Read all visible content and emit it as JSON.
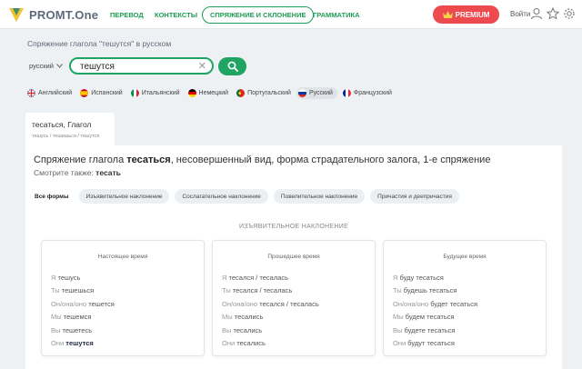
{
  "header": {
    "logo_text": "PROMT.One",
    "nav": [
      "ПЕРЕВОД",
      "КОНТЕКСТЫ",
      "СПРЯЖЕНИЕ И СКЛОНЕНИЕ",
      "ГРАММАТИКА"
    ],
    "premium_label": "PREMIUM",
    "login_label": "Войти"
  },
  "search": {
    "page_title": "Спряжение глагола \"тешутся\" в русском",
    "language": "русский",
    "query": "тешутся",
    "clear_icon": "close-icon",
    "button_icon": "search-icon"
  },
  "languages": [
    {
      "label": "Английский",
      "flag": "gb"
    },
    {
      "label": "Испанский",
      "flag": "es"
    },
    {
      "label": "Итальянский",
      "flag": "it"
    },
    {
      "label": "Немецкий",
      "flag": "de"
    },
    {
      "label": "Португальский",
      "flag": "pt"
    },
    {
      "label": "Русский",
      "flag": "ru",
      "active": true
    },
    {
      "label": "Французский",
      "flag": "fr"
    }
  ],
  "tab": {
    "title": "тесаться, Глагол",
    "subtitle": "тешусь / тешешься / тешутся"
  },
  "result": {
    "heading_prefix": "Спряжение глагола ",
    "heading_verb": "тесаться",
    "heading_suffix": ",  несовершенный вид, форма страдательного залога, 1-е спряжение",
    "seealso_label": "Смотрите также: ",
    "seealso_word": "тесать",
    "filters": [
      "Все формы",
      "Изъявительное наклонение",
      "Сослагательное наклонение",
      "Повелительное наклонение",
      "Причастия и деепричастия"
    ],
    "section_label": "ИЗЪЯВИТЕЛЬНОЕ НАКЛОНЕНИЕ",
    "tenses": [
      {
        "title": "Настоящее время",
        "forms": [
          {
            "pronoun": "Я",
            "form": "тешусь"
          },
          {
            "pronoun": "Ты",
            "form": "тешешься"
          },
          {
            "pronoun": "Он/она/оно",
            "form": "тешется"
          },
          {
            "pronoun": "Мы",
            "form": "тешемся"
          },
          {
            "pronoun": "Вы",
            "form": "тешетесь"
          },
          {
            "pronoun": "Они",
            "form": "тешутся",
            "highlight": true
          }
        ]
      },
      {
        "title": "Прошедшее время",
        "forms": [
          {
            "pronoun": "Я",
            "form": "тесался / тесалась"
          },
          {
            "pronoun": "Ты",
            "form": "тесался / тесалась"
          },
          {
            "pronoun": "Он/она/оно",
            "form": "тесался / тесалась"
          },
          {
            "pronoun": "Мы",
            "form": "тесались"
          },
          {
            "pronoun": "Вы",
            "form": "тесались"
          },
          {
            "pronoun": "Они",
            "form": "тесались"
          }
        ]
      },
      {
        "title": "Будущее время",
        "forms": [
          {
            "pronoun": "Я",
            "form": "буду тесаться"
          },
          {
            "pronoun": "Ты",
            "form": "будешь тесаться"
          },
          {
            "pronoun": "Он/она/оно",
            "form": "будет тесаться"
          },
          {
            "pronoun": "Мы",
            "form": "будем тесаться"
          },
          {
            "pronoun": "Вы",
            "form": "будете тесаться"
          },
          {
            "pronoun": "Они",
            "form": "будут тесаться"
          }
        ]
      }
    ]
  }
}
